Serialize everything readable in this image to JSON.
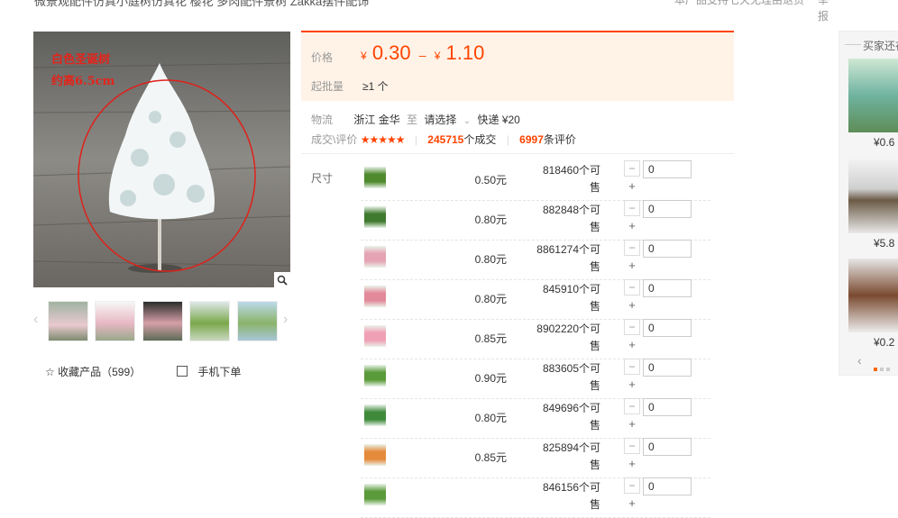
{
  "header": {
    "title": "微景观配件仿真小庭树仿真花 樱花 多肉配件景树 Zakka摆件配饰",
    "right_note": "本产品支持七天无理由退货",
    "report": "举报"
  },
  "gallery": {
    "overlay_line1": "白色圣诞树",
    "overlay_line2": "约高6.5cm",
    "zoom_icon": "search-icon",
    "prev": "‹",
    "next": "›",
    "favorite": "收藏产品（599）",
    "mobile_order": "手机下单"
  },
  "price": {
    "label": "价格",
    "currency": "¥",
    "low": "0.30",
    "sep": "–",
    "high": "1.10",
    "moq_label": "起批量",
    "moq_value": "≥1 个"
  },
  "logistics": {
    "label": "物流",
    "from": "浙江 金华",
    "to_word": "至",
    "dest": "请选择",
    "express": "快递 ¥20"
  },
  "deals": {
    "label": "成交\\评价",
    "stars": "★★★★★",
    "sep": "|",
    "deals_count": "245715",
    "deals_unit": "个成交",
    "reviews_count": "6997",
    "reviews_unit": "条评价"
  },
  "sku": {
    "label": "尺寸",
    "items": [
      {
        "price": "0.50元",
        "stock": "818460个可售",
        "qty": "0",
        "minus": "−",
        "plus": "+"
      },
      {
        "price": "0.80元",
        "stock": "882848个可售",
        "qty": "0",
        "minus": "−",
        "plus": "+"
      },
      {
        "price": "0.80元",
        "stock": "8861274个可售",
        "qty": "0",
        "minus": "−",
        "plus": "+"
      },
      {
        "price": "0.80元",
        "stock": "845910个可售",
        "qty": "0",
        "minus": "−",
        "plus": "+"
      },
      {
        "price": "0.85元",
        "stock": "8902220个可售",
        "qty": "0",
        "minus": "−",
        "plus": "+"
      },
      {
        "price": "0.90元",
        "stock": "883605个可售",
        "qty": "0",
        "minus": "−",
        "plus": "+"
      },
      {
        "price": "0.80元",
        "stock": "849696个可售",
        "qty": "0",
        "minus": "−",
        "plus": "+"
      },
      {
        "price": "0.85元",
        "stock": "825894个可售",
        "qty": "0",
        "minus": "−",
        "plus": "+"
      },
      {
        "price": "",
        "stock": "846156个可售",
        "qty": "0",
        "minus": "−",
        "plus": "+"
      }
    ]
  },
  "sidebar": {
    "title": "买家还在看",
    "items": [
      {
        "price": "¥0.6"
      },
      {
        "price": "¥5.8"
      },
      {
        "price": "¥0.2"
      }
    ],
    "prev": "‹"
  },
  "colors": {
    "accent": "#ff4400",
    "price_bg": "#fff3e8"
  }
}
